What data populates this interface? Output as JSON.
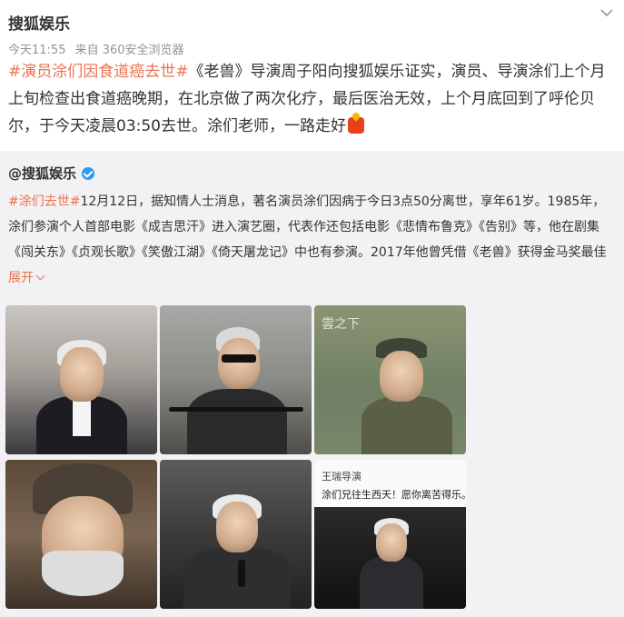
{
  "post": {
    "author": "搜狐娱乐",
    "time": "今天11:55",
    "source": "来自 360安全浏览器",
    "topic": "#演员涂们因食道癌去世#",
    "text": "《老兽》导演周子阳向搜狐娱乐证实，演员、导演涂们上个月上旬检查出食道癌晚期，在北京做了两次化疗，最后医治无效，上个月底回到了呼伦贝尔，于今天凌晨03:50去世。涂们老师，一路走好",
    "emoji": "candle-icon"
  },
  "repost": {
    "author": "@搜狐娱乐",
    "topic": "#涂们去世#",
    "text": "12月12日，据知情人士消息，著名演员涂们因病于今日3点50分离世，享年61岁。1985年，涂们参演个人首部电影《成吉思汗》进入演艺圈，代表作还包括电影《悲情布鲁克》《告别》等，他在剧集《闯关东》《贞观长歌》《笑傲江湖》《倚天屠龙记》中也有参演。2017年他曾凭借《老兽》获得金马奖最佳",
    "expand_label": "展开",
    "images": [
      {
        "name": "photo-tuxedo"
      },
      {
        "name": "photo-motorbike"
      },
      {
        "name": "photo-film-still",
        "watermark": "雲之下"
      },
      {
        "name": "photo-warrior"
      },
      {
        "name": "photo-microphone"
      },
      {
        "name": "photo-weibo-post",
        "caption_author": "王瑞导演",
        "caption_text": "涂们兄往生西天！愿你离苦得乐。"
      }
    ]
  },
  "colors": {
    "accent": "#eb7350",
    "verified": "#2d9cf4",
    "repost_bg": "#f2f2f5"
  }
}
